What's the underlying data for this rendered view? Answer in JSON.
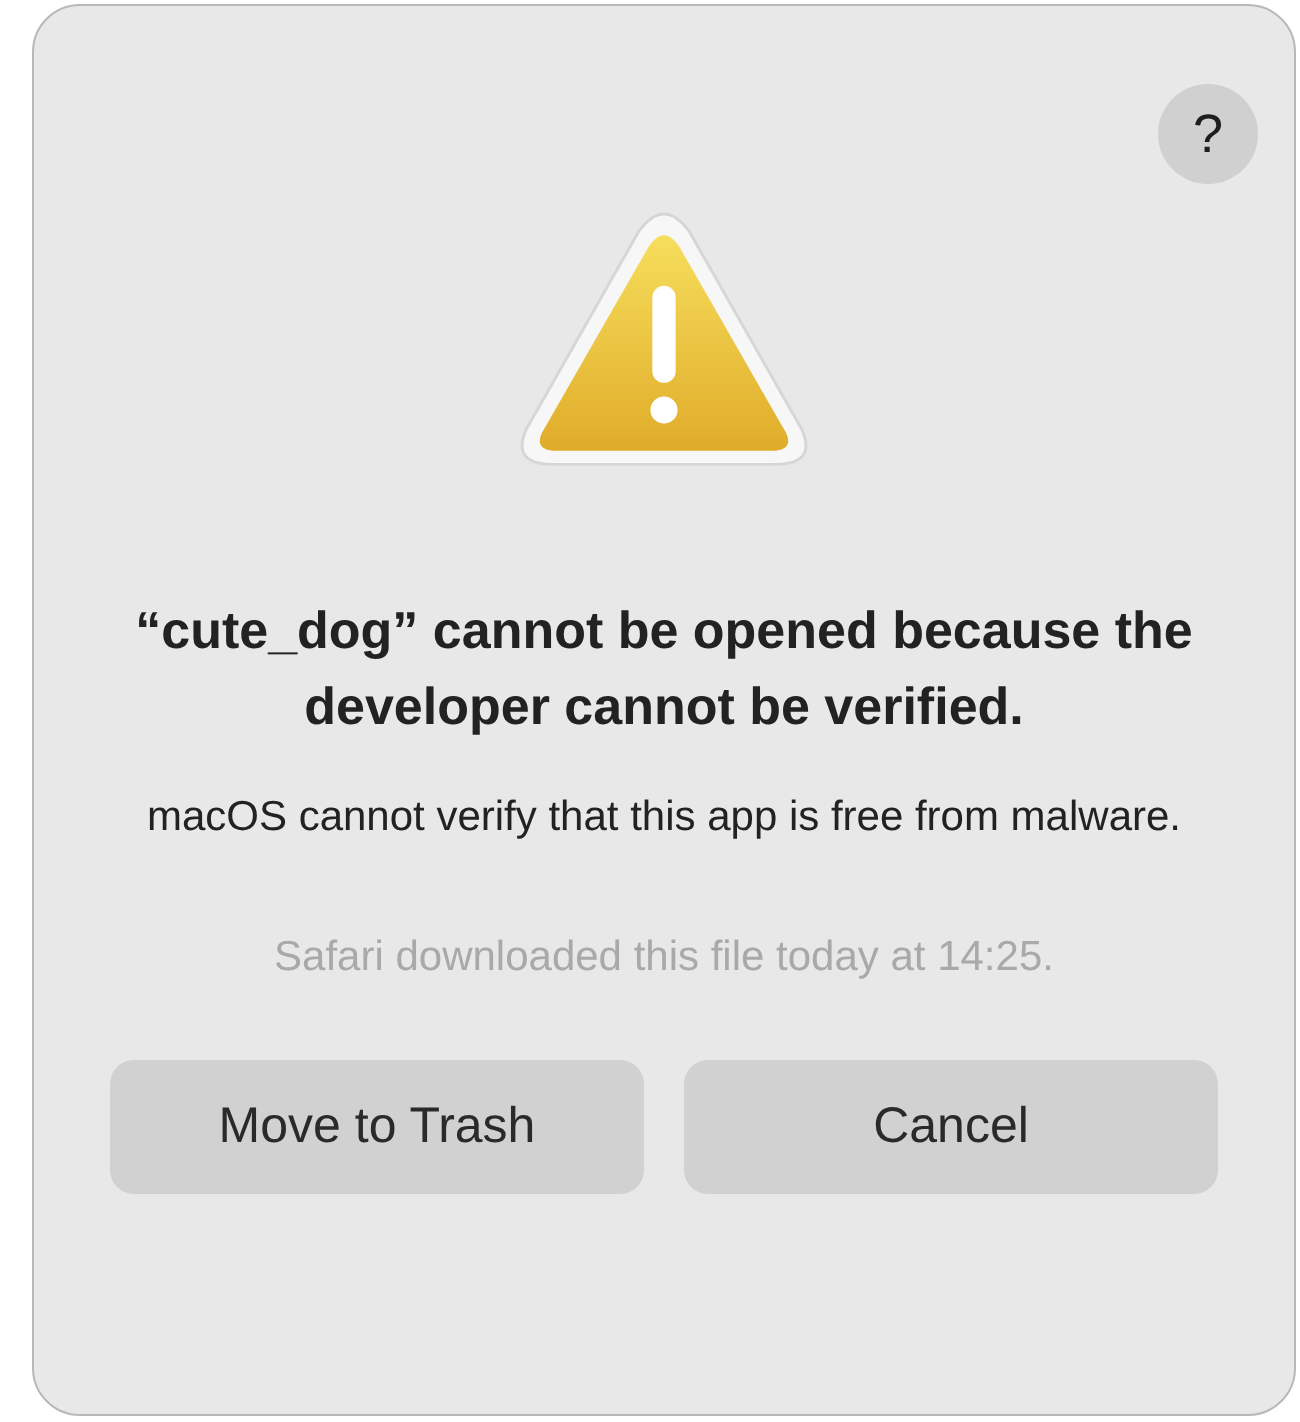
{
  "help_button": {
    "label": "?"
  },
  "title": "“cute_dog” cannot be opened because the developer cannot be verified.",
  "message": "macOS cannot verify that this app is free from malware.",
  "detail": "Safari downloaded this file today at 14:25.",
  "buttons": [
    "Move to Trash",
    "Cancel"
  ]
}
